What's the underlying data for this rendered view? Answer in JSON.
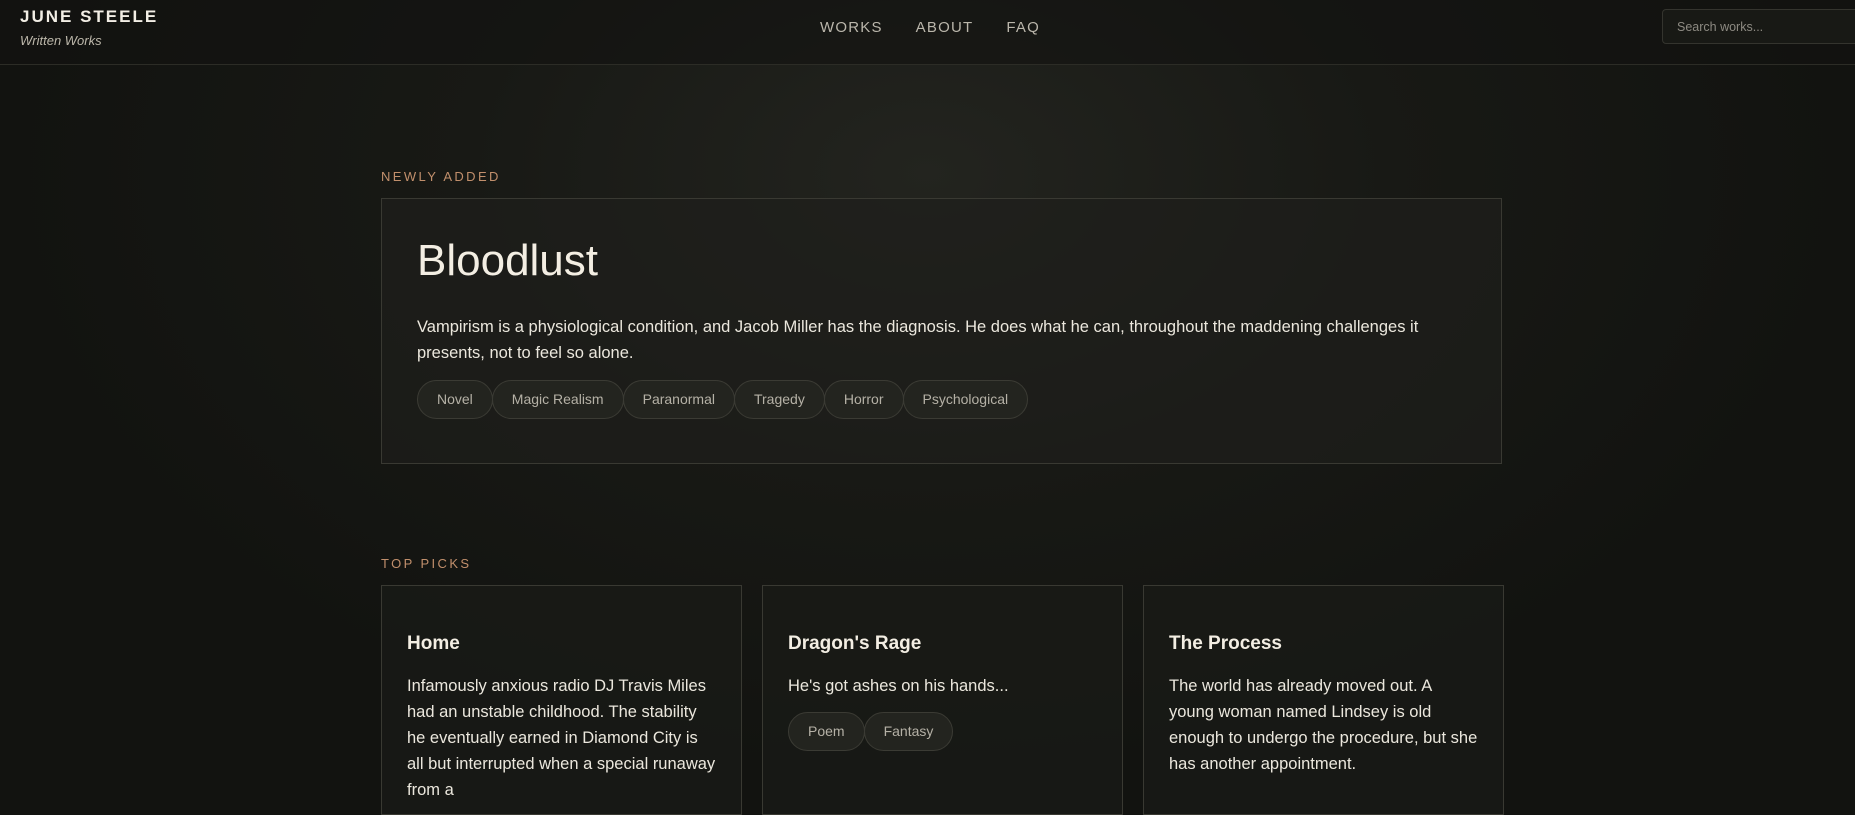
{
  "header": {
    "brand_name": "JUNE STEELE",
    "brand_tagline": "Written Works",
    "nav": [
      {
        "label": "WORKS"
      },
      {
        "label": "ABOUT"
      },
      {
        "label": "FAQ"
      }
    ],
    "search_placeholder": "Search works..."
  },
  "newly_added": {
    "label": "NEWLY ADDED",
    "title": "Bloodlust",
    "description": "Vampirism is a physiological condition, and Jacob Miller has the diagnosis. He does what he can, throughout the maddening challenges it presents, not to feel so alone.",
    "tags": [
      "Novel",
      "Magic Realism",
      "Paranormal",
      "Tragedy",
      "Horror",
      "Psychological"
    ]
  },
  "top_picks": {
    "label": "TOP PICKS",
    "cards": [
      {
        "title": "Home",
        "description": "Infamously anxious radio DJ Travis Miles had an unstable childhood. The stability he eventually earned in Diamond City is all but interrupted when a special runaway from a",
        "tags": []
      },
      {
        "title": "Dragon's Rage",
        "description": "He's got ashes on his hands...",
        "tags": [
          "Poem",
          "Fantasy"
        ]
      },
      {
        "title": "The Process",
        "description": "The world has already moved out. A young woman named Lindsey is old enough to undergo the procedure, but she has another appointment.",
        "tags": []
      }
    ]
  },
  "colors": {
    "background": "#121310",
    "accent_label": "#c18f6c",
    "text_primary": "#ebe7dd",
    "tag_text": "#b5b1a6",
    "border": "#393932"
  }
}
